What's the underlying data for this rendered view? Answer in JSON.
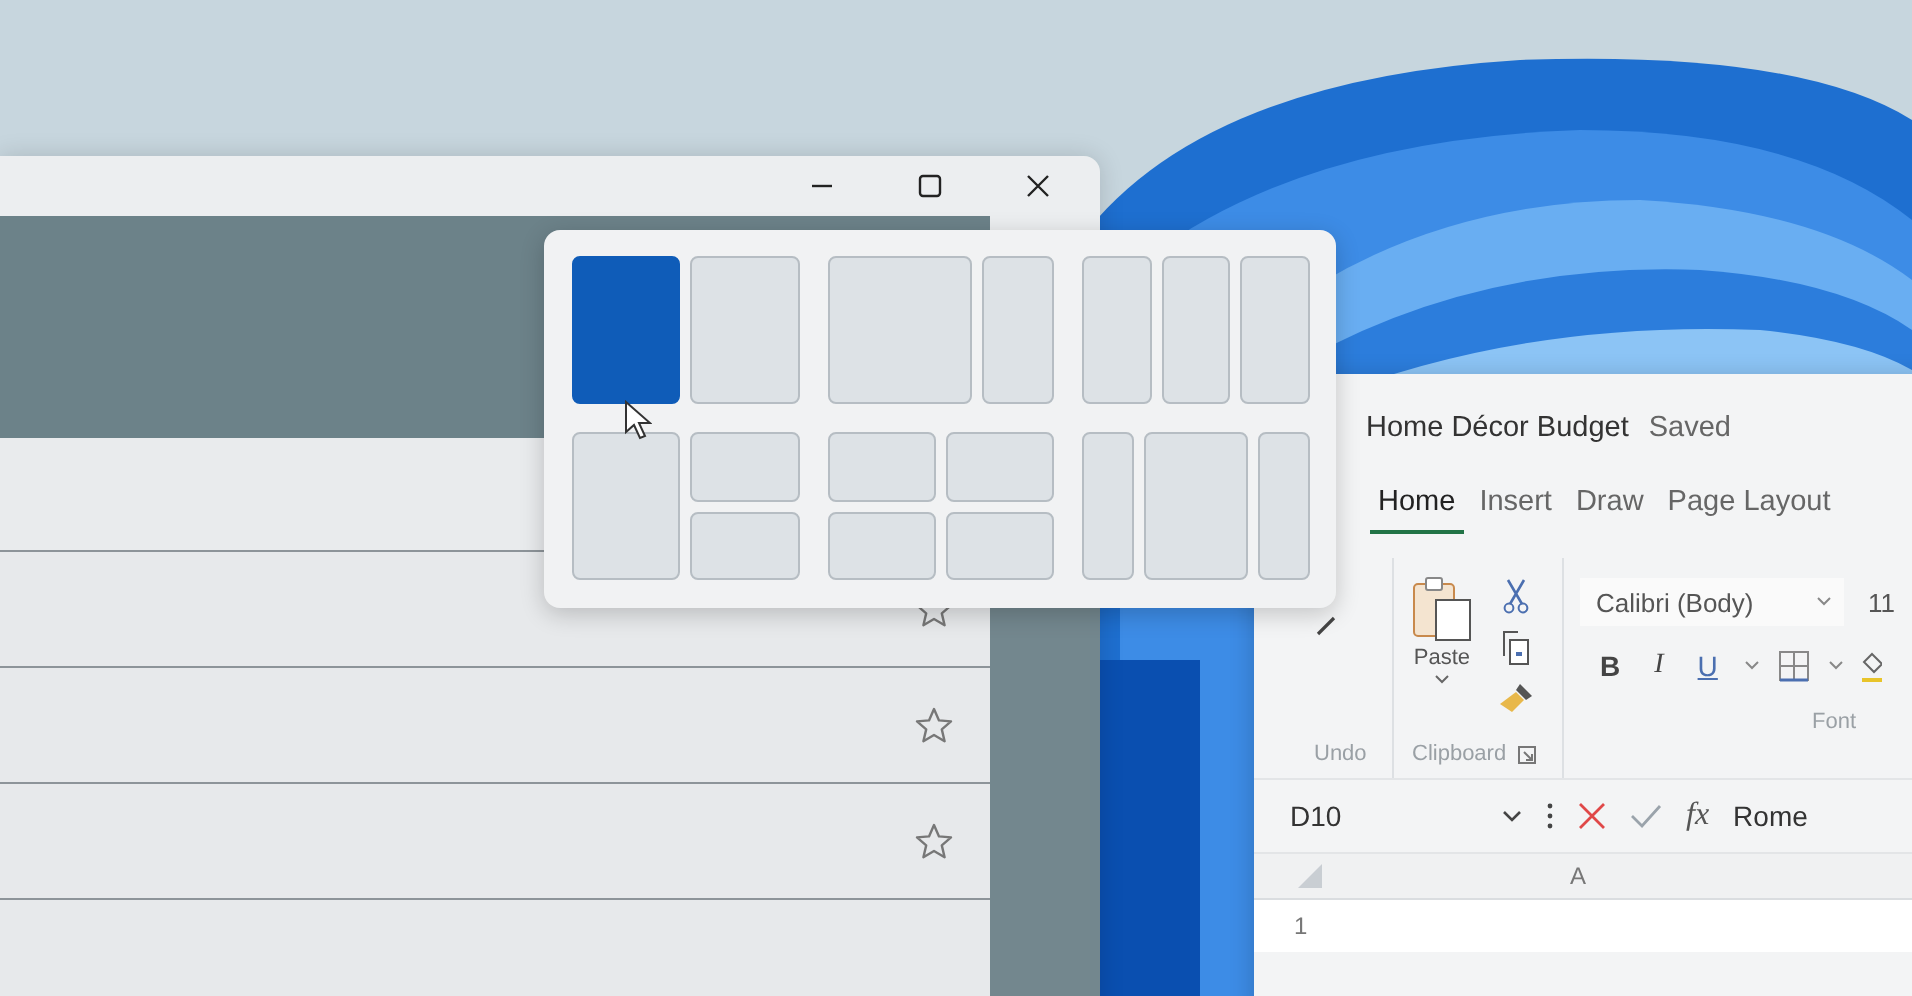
{
  "snap_layouts": [
    {
      "kind": "halves",
      "zones": [
        {
          "selected": true
        },
        {
          "selected": false
        }
      ]
    },
    {
      "kind": "wide-left",
      "zones": [
        {
          "selected": false
        },
        {
          "selected": false
        }
      ]
    },
    {
      "kind": "thirds",
      "zones": [
        {
          "selected": false
        },
        {
          "selected": false
        },
        {
          "selected": false
        }
      ]
    },
    {
      "kind": "left-stack",
      "zones": [
        {
          "selected": false
        },
        {
          "selected": false
        },
        {
          "selected": false
        }
      ]
    },
    {
      "kind": "grid",
      "zones": [
        {
          "selected": false
        },
        {
          "selected": false
        },
        {
          "selected": false
        },
        {
          "selected": false
        }
      ]
    },
    {
      "kind": "wide-center",
      "zones": [
        {
          "selected": false
        },
        {
          "selected": false
        },
        {
          "selected": false
        }
      ]
    }
  ],
  "excel": {
    "title": "Home Décor Budget",
    "status": "Saved",
    "tabs": [
      {
        "label": "Home",
        "selected": true
      },
      {
        "label": "Insert",
        "selected": false
      },
      {
        "label": "Draw",
        "selected": false
      },
      {
        "label": "Page Layout",
        "selected": false
      }
    ],
    "undo_label": "Undo",
    "paste_label": "Paste",
    "clipboard_label": "Clipboard",
    "font_label": "Font",
    "font_name": "Calibri (Body)",
    "font_size": "11",
    "bold": "B",
    "italic": "I",
    "underline": "U",
    "name_box": "D10",
    "fx": "fx",
    "formula": "Rome",
    "column": "A",
    "row": "1"
  }
}
